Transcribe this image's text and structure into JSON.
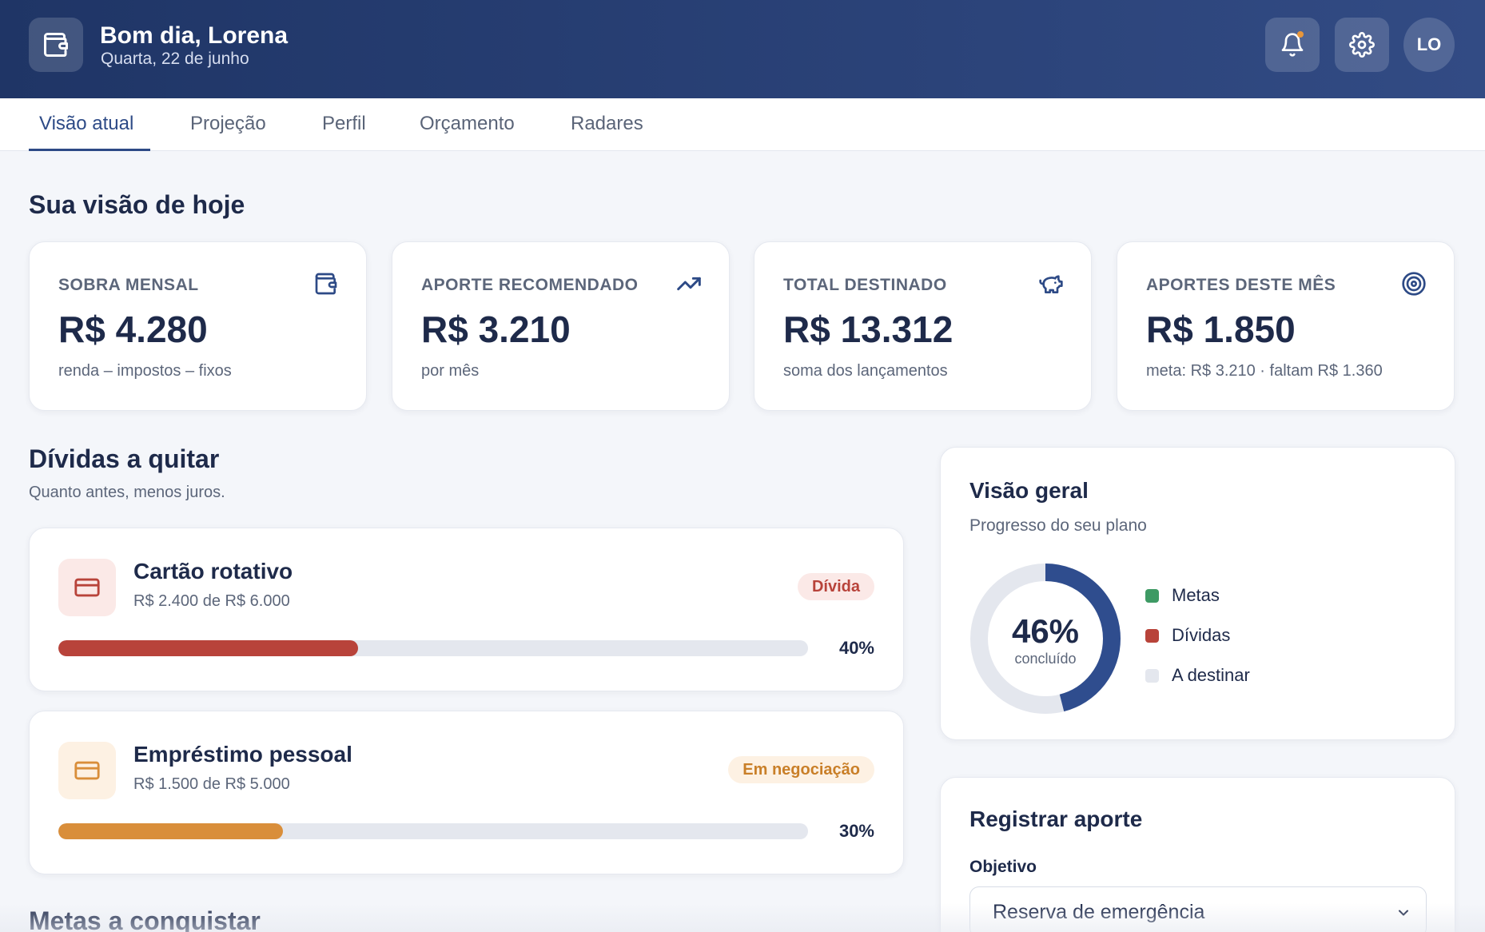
{
  "header": {
    "greeting": "Bom dia, Lorena",
    "date": "Quarta, 22 de junho",
    "avatar_initials": "LO",
    "logo_icon": "wallet-icon",
    "notification_icon": "bell-icon",
    "settings_icon": "gear-icon",
    "notification_dot_color": "#e8963a"
  },
  "tabs": [
    {
      "label": "Visão atual",
      "active": true
    },
    {
      "label": "Projeção",
      "active": false
    },
    {
      "label": "Perfil",
      "active": false
    },
    {
      "label": "Orçamento",
      "active": false
    },
    {
      "label": "Radares",
      "active": false
    }
  ],
  "today": {
    "title": "Sua visão de hoje",
    "cards": [
      {
        "label": "SOBRA MENSAL",
        "value": "R$ 4.280",
        "note": "renda – impostos – fixos",
        "icon": "wallet-icon"
      },
      {
        "label": "APORTE RECOMENDADO",
        "value": "R$ 3.210",
        "note": "por mês",
        "icon": "trending-up-icon"
      },
      {
        "label": "TOTAL DESTINADO",
        "value": "R$ 13.312",
        "note": "soma dos lançamentos",
        "icon": "piggy-bank-icon"
      },
      {
        "label": "APORTES DESTE MÊS",
        "value": "R$ 1.850",
        "note": "meta: R$ 3.210 · faltam R$ 1.360",
        "icon": "target-icon"
      }
    ]
  },
  "debts": {
    "title": "Dívidas a quitar",
    "subtitle": "Quanto antes, menos juros.",
    "items": [
      {
        "name": "Cartão rotativo",
        "amount": "R$ 2.400 de R$ 6.000",
        "badge": "Dívida",
        "percent_label": "40%",
        "progress": 0.4,
        "color": "#b8433a",
        "icon": "credit-card-icon"
      },
      {
        "name": "Empréstimo pessoal",
        "amount": "R$ 1.500 de R$ 5.000",
        "badge": "Em negociação",
        "percent_label": "30%",
        "progress": 0.3,
        "color": "#d98e3a",
        "icon": "credit-card-icon"
      }
    ]
  },
  "goals": {
    "title": "Metas a conquistar"
  },
  "overview": {
    "title": "Visão geral",
    "subtitle": "Progresso do seu plano",
    "percent": "46%",
    "percent_label": "concluído",
    "progress": 0.46,
    "legend": [
      {
        "label": "Metas",
        "color": "#3e9a64"
      },
      {
        "label": "Dívidas",
        "color": "#b8433a"
      },
      {
        "label": "A destinar",
        "color": "#e4e7ee"
      }
    ],
    "ring_color": "#2f4d8e"
  },
  "register": {
    "title": "Registrar aporte",
    "field_label": "Objetivo",
    "selected": "Reserva de emergência"
  }
}
